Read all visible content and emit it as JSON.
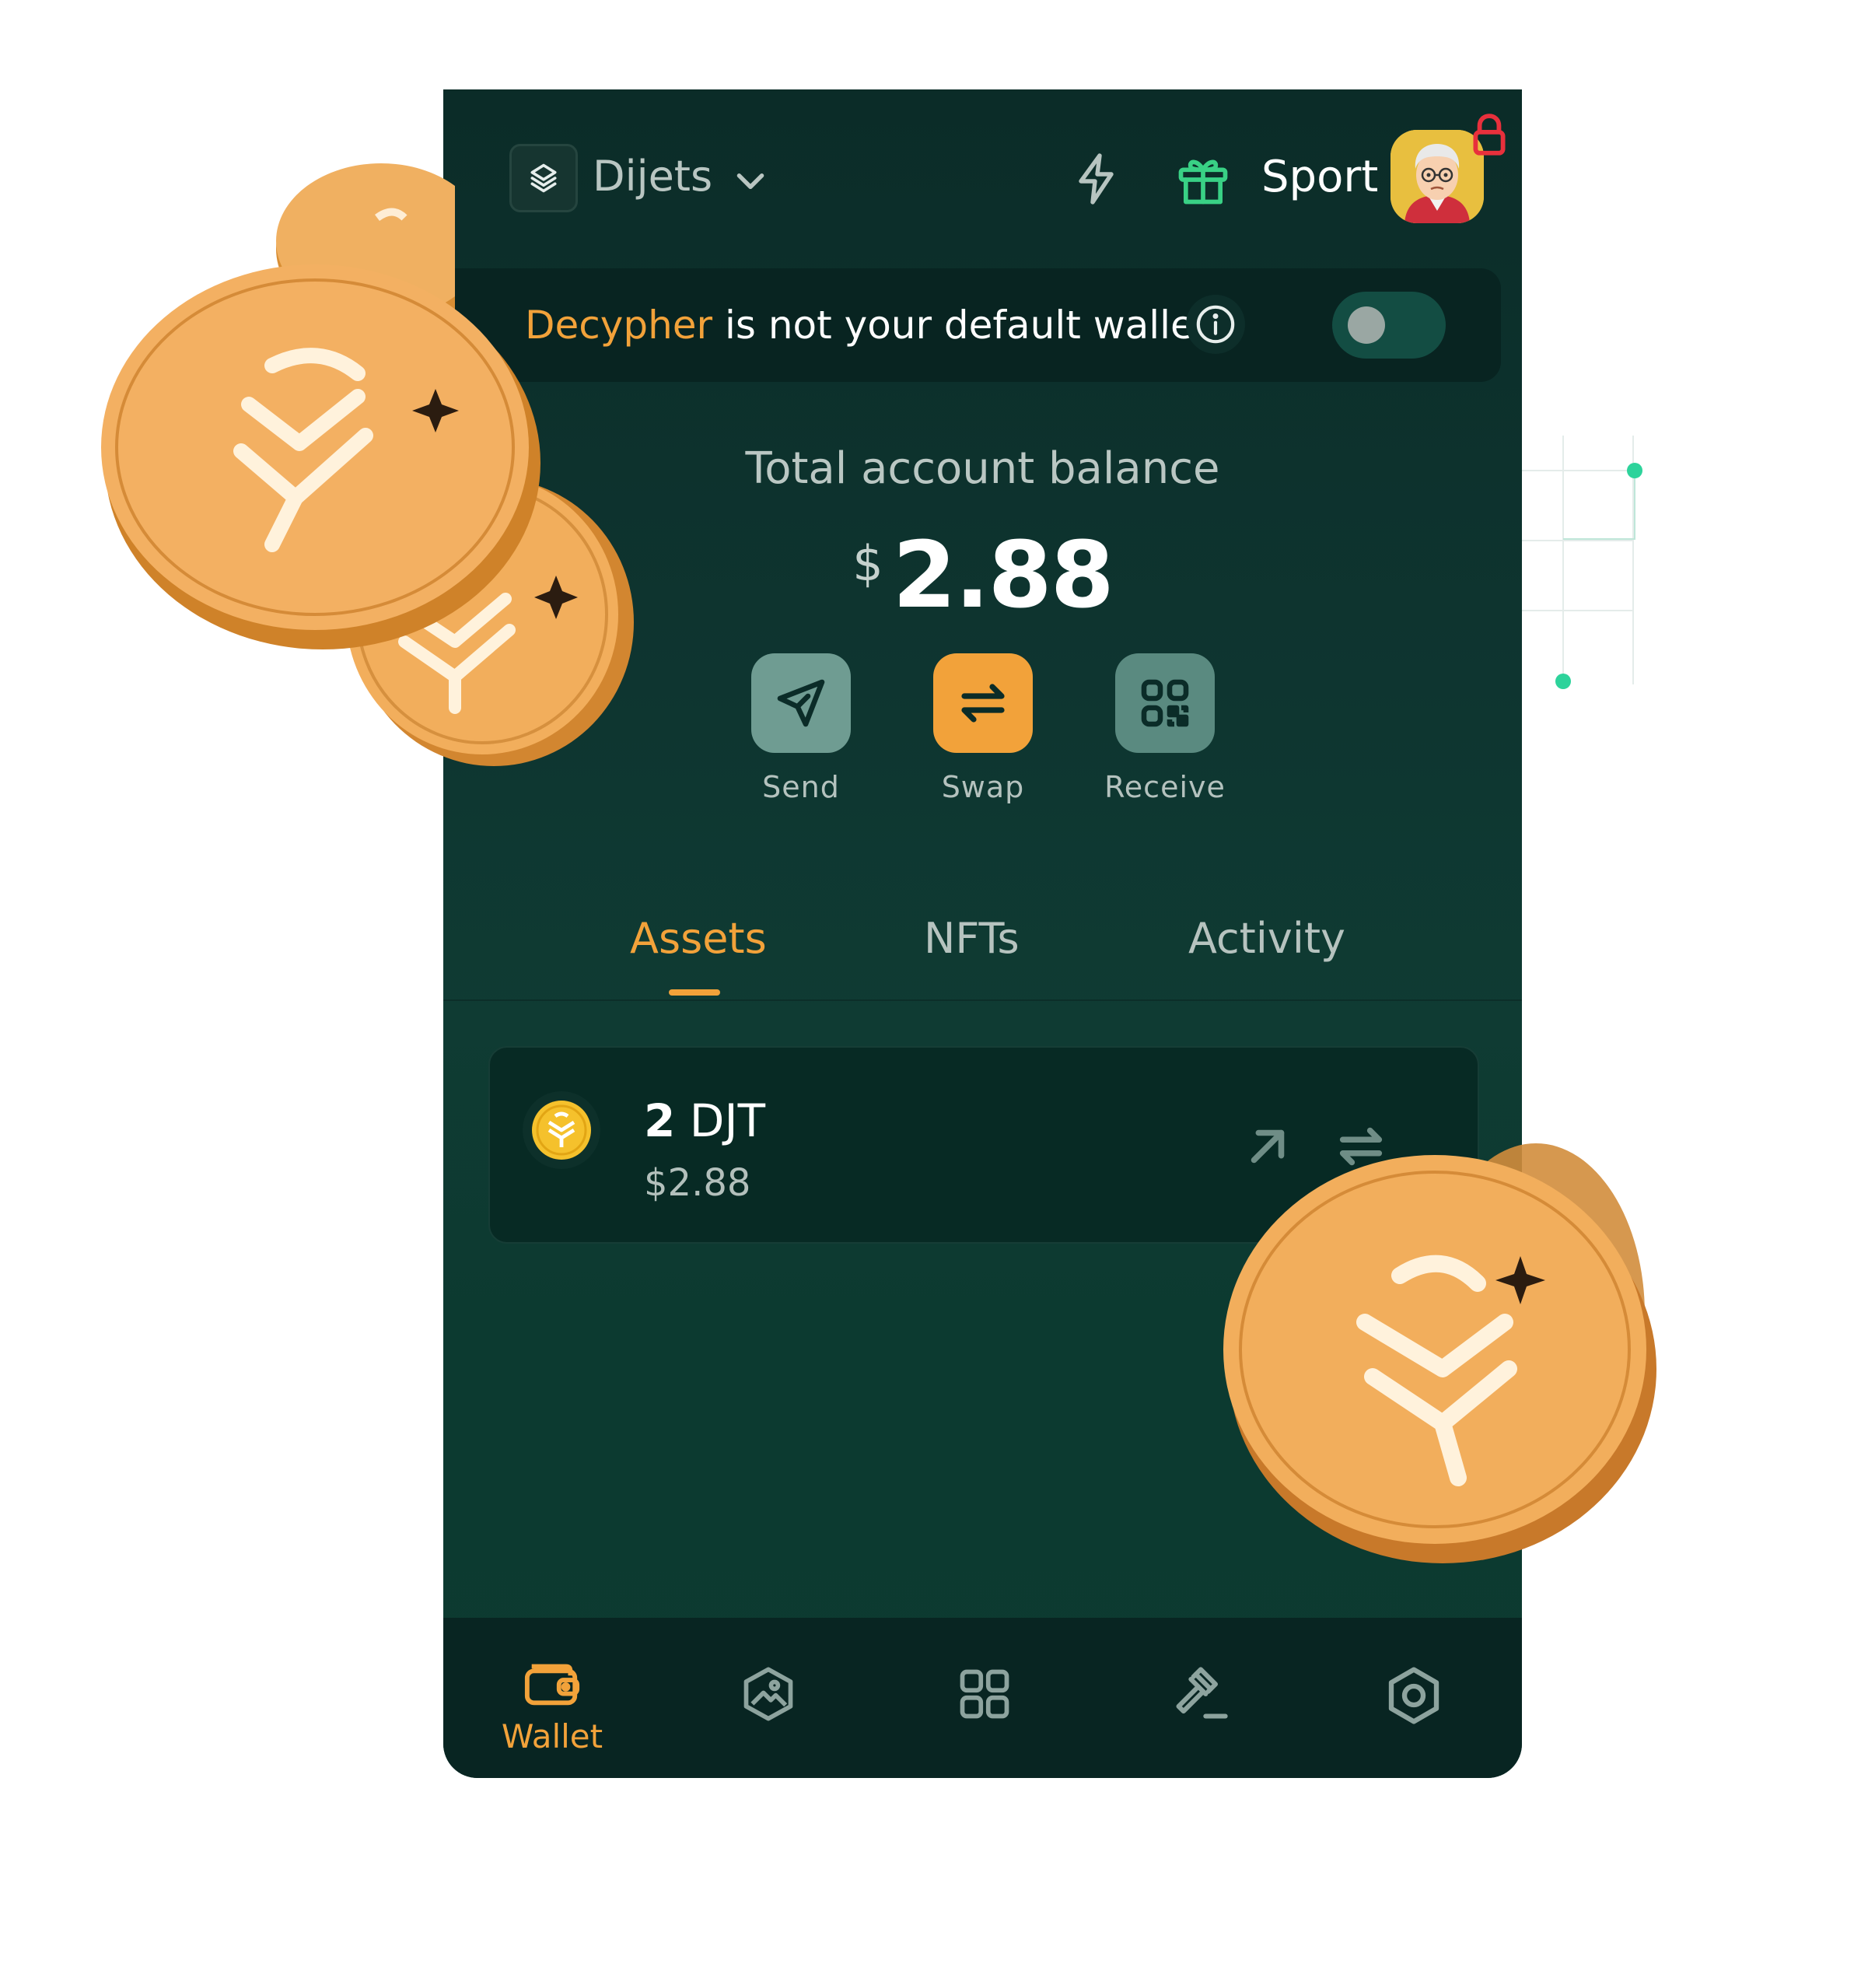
{
  "header": {
    "network_name": "Dijets",
    "account_name": "Sport"
  },
  "banner": {
    "highlight": "Decypher",
    "text": " is not your default wallet"
  },
  "balance": {
    "label": "Total account balance",
    "currency": "$",
    "value": "2.88"
  },
  "actions": [
    {
      "label": "Send",
      "icon": "send-icon"
    },
    {
      "label": "Swap",
      "icon": "swap-icon"
    },
    {
      "label": "Receive",
      "icon": "qr-icon"
    }
  ],
  "tabs": [
    {
      "label": "Assets",
      "active": true
    },
    {
      "label": "NFTs",
      "active": false
    },
    {
      "label": "Activity",
      "active": false
    }
  ],
  "assets": [
    {
      "amount": "2",
      "symbol": " DJT",
      "value": "$2.88"
    }
  ],
  "bottom_nav": {
    "wallet_label": "Wallet",
    "items": [
      "wallet-icon",
      "nft-gallery-icon",
      "apps-grid-icon",
      "governance-gavel-icon",
      "settings-hexagon-icon"
    ]
  },
  "colors": {
    "accent": "#f2a23a",
    "background": "#0e3530",
    "card": "#072a24",
    "send_button": "#6f9c92",
    "receive_button": "#5a8a80"
  }
}
